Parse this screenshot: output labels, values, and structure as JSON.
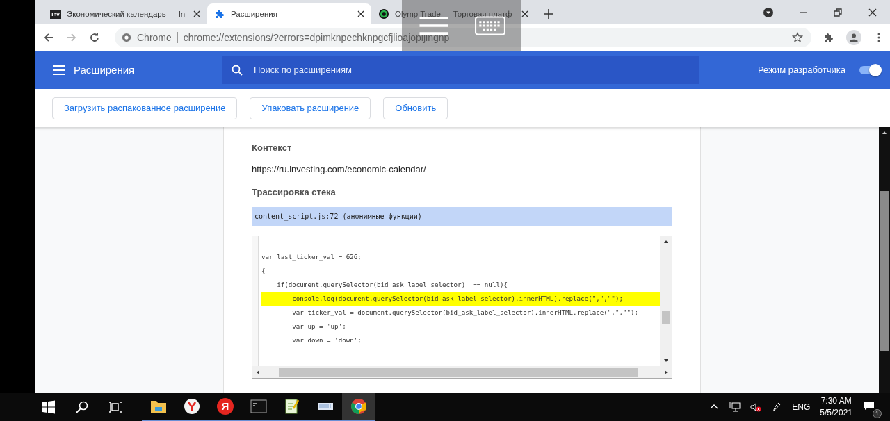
{
  "tabs": [
    {
      "kind": "site",
      "icon_text": "Inv",
      "title": "Экономический календарь — In",
      "selected": false
    },
    {
      "kind": "extension",
      "title": "Расширения",
      "selected": true
    },
    {
      "kind": "ring",
      "title": "Olymp Trade — Торговая платф",
      "selected": false
    }
  ],
  "address": {
    "chip": "Chrome",
    "url": "chrome://extensions/?errors=dpimknpechknpgcfjlioajopijingnp"
  },
  "header": {
    "title": "Расширения",
    "search_placeholder": "Поиск по расширениям",
    "dev_mode_label": "Режим разработчика",
    "dev_mode_on": true
  },
  "actions": [
    "Загрузить распакованное расширение",
    "Упаковать расширение",
    "Обновить"
  ],
  "error": {
    "context_label": "Контекст",
    "context_url": "https://ru.investing.com/economic-calendar/",
    "stack_label": "Трассировка стека",
    "stack_frame": "content_script.js:72 (анонимные функции)",
    "code_lines": [
      {
        "text": "var last_ticker_val = 626;",
        "highlighted": false
      },
      {
        "text": "{",
        "highlighted": false
      },
      {
        "text": "    if(document.querySelector(bid_ask_label_selector) !== null){",
        "highlighted": false
      },
      {
        "text": "        console.log(document.querySelector(bid_ask_label_selector).innerHTML).replace(\",\",\"\");",
        "highlighted": true
      },
      {
        "text": "        var ticker_val = document.querySelector(bid_ask_label_selector).innerHTML.replace(\",\",\"\");",
        "highlighted": false
      },
      {
        "text": "        var up = 'up';",
        "highlighted": false
      },
      {
        "text": "        var down = 'down';",
        "highlighted": false
      }
    ]
  },
  "taskbar": {
    "apps": [
      {
        "kind": "folder",
        "active": false
      },
      {
        "kind": "ybrowser",
        "active": false
      },
      {
        "kind": "yandex",
        "label": "Я",
        "active": false
      },
      {
        "kind": "terminal",
        "active": false
      },
      {
        "kind": "notepad",
        "active": false
      },
      {
        "kind": "keyboard",
        "active": false
      },
      {
        "kind": "chrome",
        "active": true
      }
    ],
    "language": "ENG",
    "time": "7:30 AM",
    "date": "5/5/2021",
    "notification_count": "1"
  }
}
